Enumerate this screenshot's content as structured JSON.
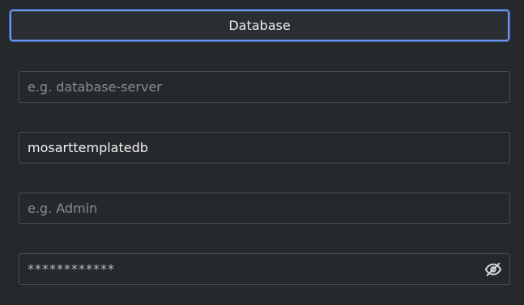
{
  "header": {
    "title": "Database"
  },
  "fields": {
    "server": {
      "value": "",
      "placeholder": "e.g. database-server"
    },
    "database_name": {
      "value": "mosarttemplatedb",
      "placeholder": ""
    },
    "username": {
      "value": "",
      "placeholder": "e.g. Admin"
    },
    "password": {
      "masked_value": "************",
      "visibility_icon": "eye-slash-icon"
    }
  },
  "colors": {
    "background": "#26292c",
    "focus_ring": "#6f95e6",
    "border": "#4a4d52",
    "text": "#f2f2f2",
    "placeholder": "#8a8d91"
  }
}
